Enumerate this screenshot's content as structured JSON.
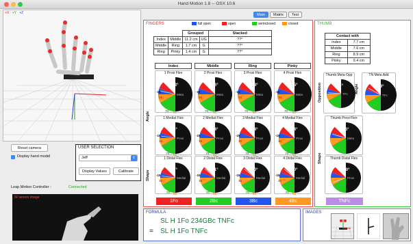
{
  "window": {
    "title": "Hand Motion 1.8 -- OSX 10.6"
  },
  "axes_legend": {
    "x": "+X",
    "y": "+Y",
    "z": "+Z"
  },
  "tabs": [
    {
      "label": "Main",
      "active": true
    },
    {
      "label": "Matrix",
      "active": false
    },
    {
      "label": "Test",
      "active": false
    }
  ],
  "fingers": {
    "title": "FINGERS",
    "legend": [
      {
        "label": "full open",
        "color": "#2255ee"
      },
      {
        "label": "open",
        "color": "#ee2222"
      },
      {
        "label": "semiclosed",
        "color": "#22cc22"
      },
      {
        "label": "closed",
        "color": "#ff9922"
      }
    ],
    "grouped_header": "Grouped",
    "stacked_header": "Stacked",
    "grouped_rows": [
      [
        "Index",
        "Middle",
        "11.2 cm",
        "UG",
        "??°"
      ],
      [
        "Middle",
        "Ring",
        "1.7 cm",
        "G",
        "??°"
      ],
      [
        "Ring",
        "Pinky",
        "1.4 cm",
        "G",
        "??°"
      ]
    ],
    "columns": [
      "Index",
      "Middle",
      "Ring",
      "Pinky"
    ],
    "row_labels": {
      "angle": "Angle",
      "shape": "Shape"
    },
    "gauges": [
      [
        {
          "title": "1 Proxi Flex",
          "value": "13°",
          "meta": "Meta",
          "scale_left": "-15",
          "scale_mid": "15",
          "scale_bottom": "70",
          "scale_bottom2": "90"
        },
        {
          "title": "2 Proxi Flex",
          "value": "76°",
          "meta": "Meta",
          "scale_left": "-15",
          "scale_mid": "15",
          "scale_bottom": "70",
          "scale_bottom2": "90"
        },
        {
          "title": "3 Proxi Flex",
          "value": "78°",
          "meta": "Meta",
          "scale_left": "-15",
          "scale_mid": "15",
          "scale_bottom": "70",
          "scale_bottom2": "90"
        },
        {
          "title": "4 Proxi Flex",
          "value": "75°",
          "meta": "Meta",
          "scale_left": "-15",
          "scale_mid": "15",
          "scale_bottom": "70",
          "scale_bottom2": "90"
        }
      ],
      [
        {
          "title": "1 Medial Flex",
          "value": "8°",
          "meta": "Proxi",
          "scale_left": "-15",
          "scale_mid": "15",
          "scale_bottom": "70",
          "scale_bottom2": "90"
        },
        {
          "title": "2 Medial Flex",
          "value": "84°",
          "meta": "Proxi",
          "scale_left": "-15",
          "scale_mid": "15",
          "scale_bottom": "70",
          "scale_bottom2": "90"
        },
        {
          "title": "3 Medial Flex",
          "value": "84°",
          "meta": "Proxi",
          "scale_left": "-15",
          "scale_mid": "15",
          "scale_bottom": "70",
          "scale_bottom2": "90"
        },
        {
          "title": "4 Medial Flex",
          "value": "84°",
          "meta": "Proxi",
          "scale_left": "-15",
          "scale_mid": "15",
          "scale_bottom": "70",
          "scale_bottom2": "90"
        }
      ],
      [
        {
          "title": "1 Distal Flex",
          "value": "7°",
          "meta": "Medial",
          "scale_left": "-15",
          "scale_mid": "15",
          "scale_bottom": "70",
          "scale_bottom2": "90"
        },
        {
          "title": "2 Distal Flex",
          "value": "41°",
          "meta": "Medial",
          "scale_left": "-15",
          "scale_mid": "15",
          "scale_bottom": "70",
          "scale_bottom2": "90"
        },
        {
          "title": "3 Distal Flex",
          "value": "40°",
          "meta": "Medial",
          "scale_left": "-15",
          "scale_mid": "15",
          "scale_bottom": "70",
          "scale_bottom2": "90"
        },
        {
          "title": "4 Distal Flex",
          "value": "40°",
          "meta": "Medial",
          "scale_left": "-15",
          "scale_mid": "15",
          "scale_bottom": "70",
          "scale_bottom2": "90"
        }
      ]
    ],
    "codes": [
      {
        "label": "1Fo",
        "color": "#ee2222"
      },
      {
        "label": "2Bc",
        "color": "#22cc22"
      },
      {
        "label": "3Bc",
        "color": "#2255ee"
      },
      {
        "label": "4Bc",
        "color": "#ff9922"
      }
    ]
  },
  "thumb": {
    "title": "THUMB",
    "contact_header": "Contact with",
    "contact_rows": [
      [
        "Index",
        "7.7 cm"
      ],
      [
        "Middle",
        "7.6 cm"
      ],
      [
        "Ring",
        "8.9 cm"
      ],
      [
        "Pinky",
        "9.4 cm"
      ]
    ],
    "row_labels": {
      "opposition": "Opposition",
      "angle": "Angle",
      "shape": "Shape"
    },
    "gauges": [
      {
        "title": "Thumb Meta Opp",
        "value": "4°",
        "meta": "TFc"
      },
      {
        "title": "TN Meta Add",
        "value": "29°",
        "meta": "TFc"
      },
      {
        "title": "Thumb Proxi Flex",
        "value": "16°",
        "meta": "Meta"
      },
      {
        "title": "Thumb Distal Flex",
        "value": "-20°",
        "meta": "Proxi"
      }
    ],
    "code": {
      "label": "TNFc",
      "color": "#b98ce6"
    }
  },
  "left_panel": {
    "reset_button": "Reset camera",
    "display_hand_model": "Display hand model",
    "user_selection_title": "USER SELECTION",
    "user_value": "Jeff",
    "display_values_button": "Display Values",
    "calibrate_button": "Calibrate",
    "leap_label": "Leap Motion Controller :",
    "leap_status": "Connected",
    "ir_label": "IR sensor image"
  },
  "formula": {
    "title": "FORMULA",
    "line1": "SL H 1Fo 234GBc TNFc",
    "equals": "=",
    "line2": "SL H 1Fo TNFc"
  },
  "images": {
    "title": "IMAGES"
  }
}
